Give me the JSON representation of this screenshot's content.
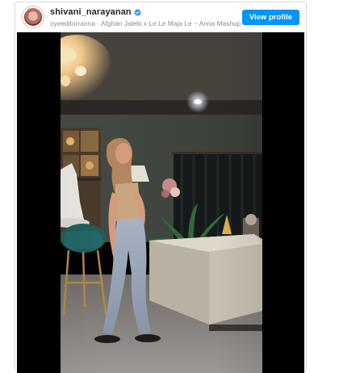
{
  "post": {
    "username": "shivani_narayanan",
    "verified": true,
    "audio": "oyeeditorranna · Afghan Jalebi x Le Le Maja Le ~ Anna Mashup",
    "view_profile_label": "View profile"
  },
  "colors": {
    "accent": "#0095f6",
    "verified_badge": "#3897f0",
    "border": "#dbdbdb"
  },
  "icons": {
    "verified": "verified-badge-icon"
  }
}
